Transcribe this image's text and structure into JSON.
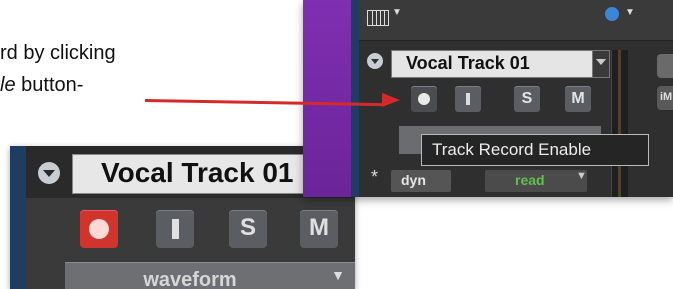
{
  "caption": {
    "line1": "rd by clicking",
    "line2_italic": "le",
    "line2_rest": " button-"
  },
  "zoom_left": {
    "track_name": "Vocal Track 01",
    "buttons": {
      "input": "I",
      "solo": "S",
      "mute": "M"
    },
    "view_selector": "waveform"
  },
  "zoom_right": {
    "track_name": "Vocal Track 01",
    "buttons": {
      "input": "I",
      "solo": "S",
      "mute": "M"
    },
    "tooltip": "Track Record Enable",
    "dyn_label": "dyn",
    "read_label": "read",
    "right_badge": "iM",
    "asterisk": "*"
  },
  "colors": {
    "record_red": "#d0342c",
    "purple": "#7f2fb1",
    "callout_arrow": "#d62a2a",
    "read_green": "#5ec24b"
  },
  "icons": [
    "grid-icon",
    "moon-icon",
    "record-icon",
    "input-icon",
    "chevron-down-icon",
    "arrow-icon"
  ]
}
